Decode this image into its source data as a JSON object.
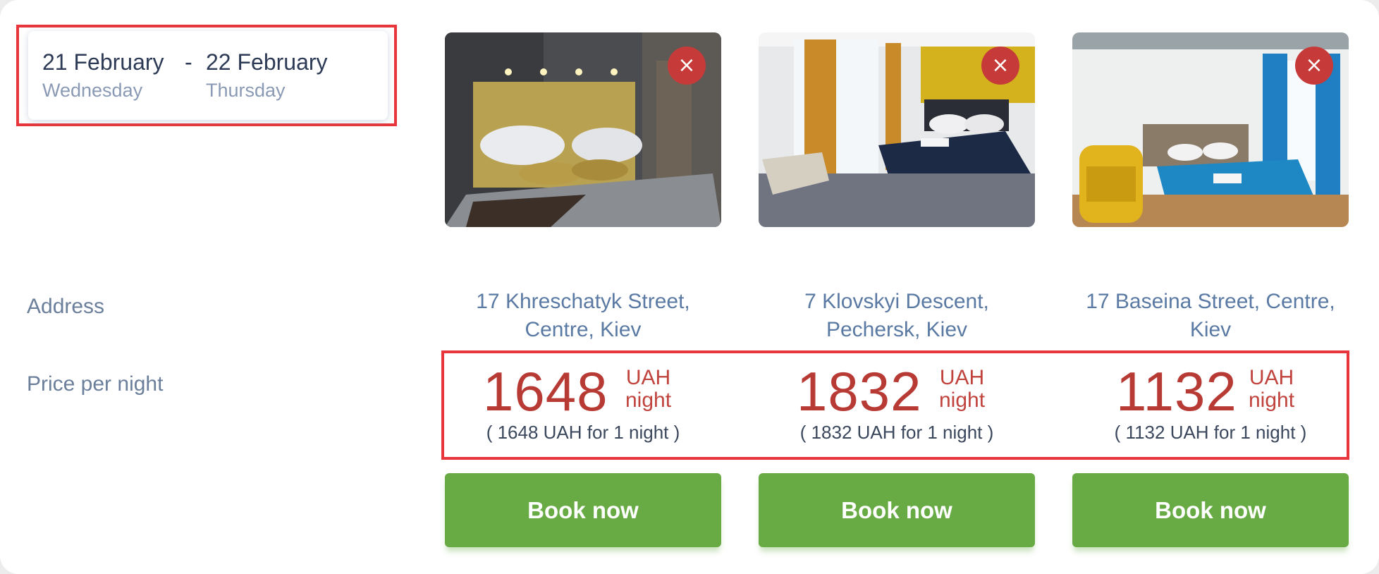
{
  "dates": {
    "check_in": {
      "date": "21 February",
      "weekday": "Wednesday"
    },
    "separator": "-",
    "check_out": {
      "date": "22 February",
      "weekday": "Thursday"
    }
  },
  "labels": {
    "address": "Address",
    "price_per_night": "Price per night"
  },
  "remove_icon": "×",
  "hotels": [
    {
      "address_line1": "17 Khreschatyk Street,",
      "address_line2": "Centre, Kiev",
      "price": "1648",
      "currency": "UAH",
      "per": "night",
      "note": "( 1648 UAH for 1 night )",
      "book_label": "Book now"
    },
    {
      "address_line1": "7 Klovskyi Descent,",
      "address_line2": "Pechersk, Kiev",
      "price": "1832",
      "currency": "UAH",
      "per": "night",
      "note": "( 1832 UAH for 1 night )",
      "book_label": "Book now"
    },
    {
      "address_line1": "17 Baseina Street, Centre,",
      "address_line2": "Kiev",
      "price": "1132",
      "currency": "UAH",
      "per": "night",
      "note": "( 1132 UAH for 1 night )",
      "book_label": "Book now"
    }
  ],
  "colors": {
    "price": "#b83a35",
    "book_button": "#68ab44",
    "remove_button": "#c63b39",
    "highlight": "#e8353b",
    "address": "#5a7aa3"
  }
}
